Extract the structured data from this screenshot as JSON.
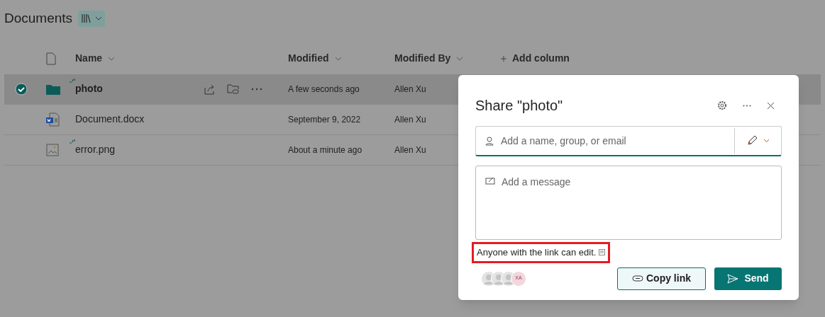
{
  "library": {
    "title": "Documents"
  },
  "columns": [
    {
      "label": "Name"
    },
    {
      "label": "Modified"
    },
    {
      "label": "Modified By"
    }
  ],
  "add_column": "Add column",
  "rows": [
    {
      "kind": "folder",
      "name": "photo",
      "modified": "A few seconds ago",
      "modified_by": "Allen Xu",
      "selected": true,
      "new": true
    },
    {
      "kind": "word",
      "name": "Document.docx",
      "modified": "September 9, 2022",
      "modified_by": "Allen Xu",
      "selected": false,
      "new": false
    },
    {
      "kind": "image",
      "name": "error.png",
      "modified": "About a minute ago",
      "modified_by": "Allen Xu",
      "selected": false,
      "new": true
    }
  ],
  "dialog": {
    "title": "Share \"photo\"",
    "recipient_placeholder": "Add a name, group, or email",
    "message_placeholder": "Add a message",
    "link_notice": "Anyone with the link can edit.",
    "link_notice_highlighted": true,
    "avatars": [
      {
        "kind": "silhouette"
      },
      {
        "kind": "silhouette"
      },
      {
        "kind": "silhouette"
      },
      {
        "kind": "initials",
        "initials": "XA"
      }
    ],
    "copy_button": "Copy link",
    "send_button": "Send"
  }
}
